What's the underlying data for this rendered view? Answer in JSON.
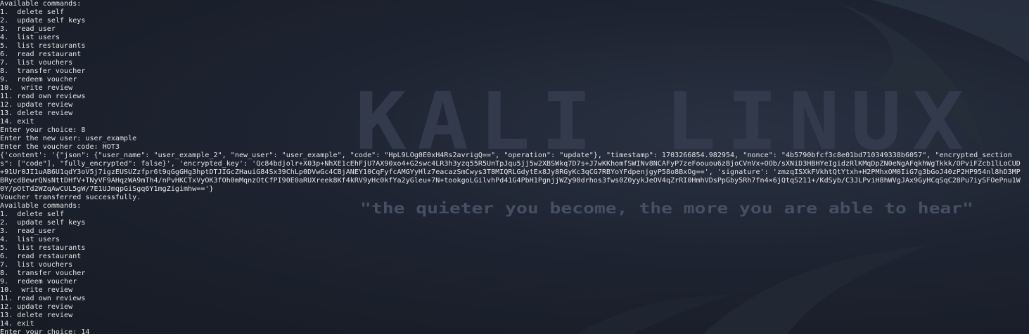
{
  "wallpaper": {
    "logo_text": "KALI LINUX",
    "tagline": "\"the quieter you become, the more you are able to hear\""
  },
  "terminal": {
    "lines": [
      "Available commands:",
      "1.  delete self",
      "2.  update self keys",
      "3.  read_user",
      "4.  list users",
      "5.  list restaurants",
      "6.  read restaurant",
      "7.  list vouchers",
      "8.  transfer voucher",
      "9.  redeem voucher",
      "10.  write review",
      "11. read own reviews",
      "12. update review",
      "13. delete review",
      "14. exit",
      "Enter your choice: 8",
      "Enter the new user: user_example",
      "Enter the voucher code: HOT3"
    ],
    "response": "{'content': '{\"json\": {\"user_name\": \"user_example_2\", \"new_user\": \"user_example\", \"code\": \"HpL9LOg0E0xH4Rs2avrigQ==\", \"operation\": \"update\"}, \"timestamp\": 1703266854.982954, \"nonce\": \"4b5790bfcf3c8e01bd710349338b6057\", \"encrypted_sections\": [\"code\"], \"fully_encrypted\": false}', 'encrypted_key': 'Qc84bdjolr+X03p+NhXE1cEhFjU7AX90xo4+G2swc4LR3h3yzq55R5UnTpJqu5jj5w2XBSWkq7D7s+J7wKKhomfSWINv8NCAFyP7zeFoouou6zBjoCVnVx+OOb/sXNiD3HBHYeIgidzRlKMqDpZN0eNgAFqkhWgTkkk/OPviFZcb1lLoCUD+91Ur0JI1uAB6U1qdY3oV5j7igzEUSUZzfpr6t9qGgGHg3hptDTJIGcZHauiG84Sx39ChLp0DVwGc4CBjANEY10CqFyfcAMGYyHlz7eacazSmCwys3T8MIQRLGdytEx8Jy8RGyKc3qCG7RBYoYFdpenjgyP58o8BxOg==', 'signature': 'zmzqISXkFVkhtQtYtxh+H2PMhxOM0IiG7g3bGoJ40zP2HP954nl8hD3MPBRycdBewrQNsNttDHfV+TNyVF9AHqzWA9mTh4/nPvHKCTxVyOK3fOh0mMqnzOtCfPI90E0aRUXreek8Kf4kRV9yHc0kfYa2yGleu+7N+tookgoLGilvhPd41G4PbH1PgnjjWZy90drhos3fws0Z0yykJeOV4qZrRI0HmhVDsPpGby5Rh7fn4×6jQtqS211+/KdSyb/C3JLPviH8hWVgJAx9GyHCqSqC28Pu7iySFOePnu1W0Y/pOtTd2WZqAwCUL5gW/7E1UJmqpGiSgq6Y1mgZigimhw=='}",
    "after_lines": [
      "Voucher transferred successfully.",
      "Available commands:",
      "1.  delete self",
      "2.  update self keys",
      "3.  read_user",
      "4.  list users",
      "5.  list restaurants",
      "6.  read restaurant",
      "7.  list vouchers",
      "8.  transfer voucher",
      "9.  redeem voucher",
      "10.  write review",
      "11. read own reviews",
      "12. update review",
      "13. delete review",
      "14. exit",
      "Enter your choice: 14"
    ]
  },
  "colors": {
    "text": "#e6e6e6",
    "background": "#1d2330",
    "logo": "#3a4356",
    "tagline": "#4a5468"
  }
}
